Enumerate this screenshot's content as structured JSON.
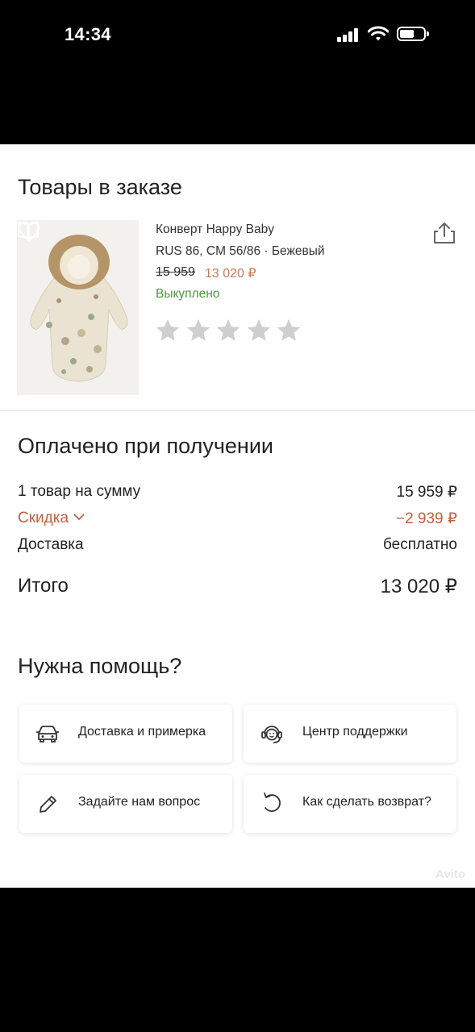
{
  "status_bar": {
    "time": "14:34"
  },
  "order_items": {
    "title": "Товары в заказе",
    "product": {
      "name": "Конверт Happy Baby",
      "variant": "RUS 86, CM 56/86 · Бежевый",
      "price_old": "15 959",
      "price_new": "13 020 ₽",
      "status": "Выкуплено",
      "rating_stars_total": 5,
      "rating_stars_filled": 0,
      "colors": {
        "price_new": "#c97a57",
        "status": "#4a9a3c"
      }
    }
  },
  "payment": {
    "title": "Оплачено при получении",
    "items_label": "1 товар на сумму",
    "items_value": "15 959 ₽",
    "discount_label": "Скидка",
    "discount_value": "−2 939 ₽",
    "delivery_label": "Доставка",
    "delivery_value": "бесплатно",
    "total_label": "Итого",
    "total_value": "13 020 ₽",
    "colors": {
      "discount": "#c0603f"
    }
  },
  "help": {
    "title": "Нужна помощь?",
    "cards": [
      {
        "label": "Доставка и примерка",
        "icon": "car-icon"
      },
      {
        "label": "Центр поддержки",
        "icon": "headset-icon"
      },
      {
        "label": "Задайте нам вопрос",
        "icon": "pencil-icon"
      },
      {
        "label": "Как сделать возврат?",
        "icon": "return-arrow-icon"
      }
    ]
  },
  "watermark": "Avito"
}
